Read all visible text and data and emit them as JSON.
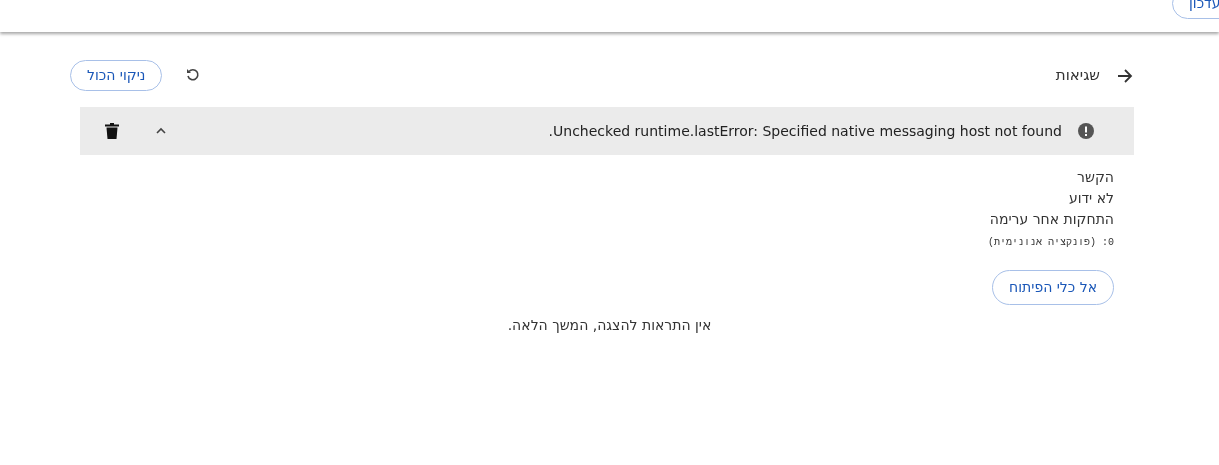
{
  "toolbar": {
    "update_button": "עדכון"
  },
  "header": {
    "title": "שגיאות",
    "clear_all_button": "ניקוי הכול"
  },
  "error": {
    "message": "Unchecked runtime.lastError: Specified native messaging host not found.",
    "expanded": true,
    "details": [
      {
        "kind": "heading",
        "text": "הקשר"
      },
      {
        "kind": "text",
        "text": "לא ידוע"
      },
      {
        "kind": "heading",
        "text": "התחקות אחר ערימה"
      },
      {
        "kind": "code",
        "text": "0: (פונקציה אנונימית)"
      }
    ],
    "devtools_button": "אל כלי הפיתוח"
  },
  "footer": "אין התראות להצגה, המשך הלאה."
}
